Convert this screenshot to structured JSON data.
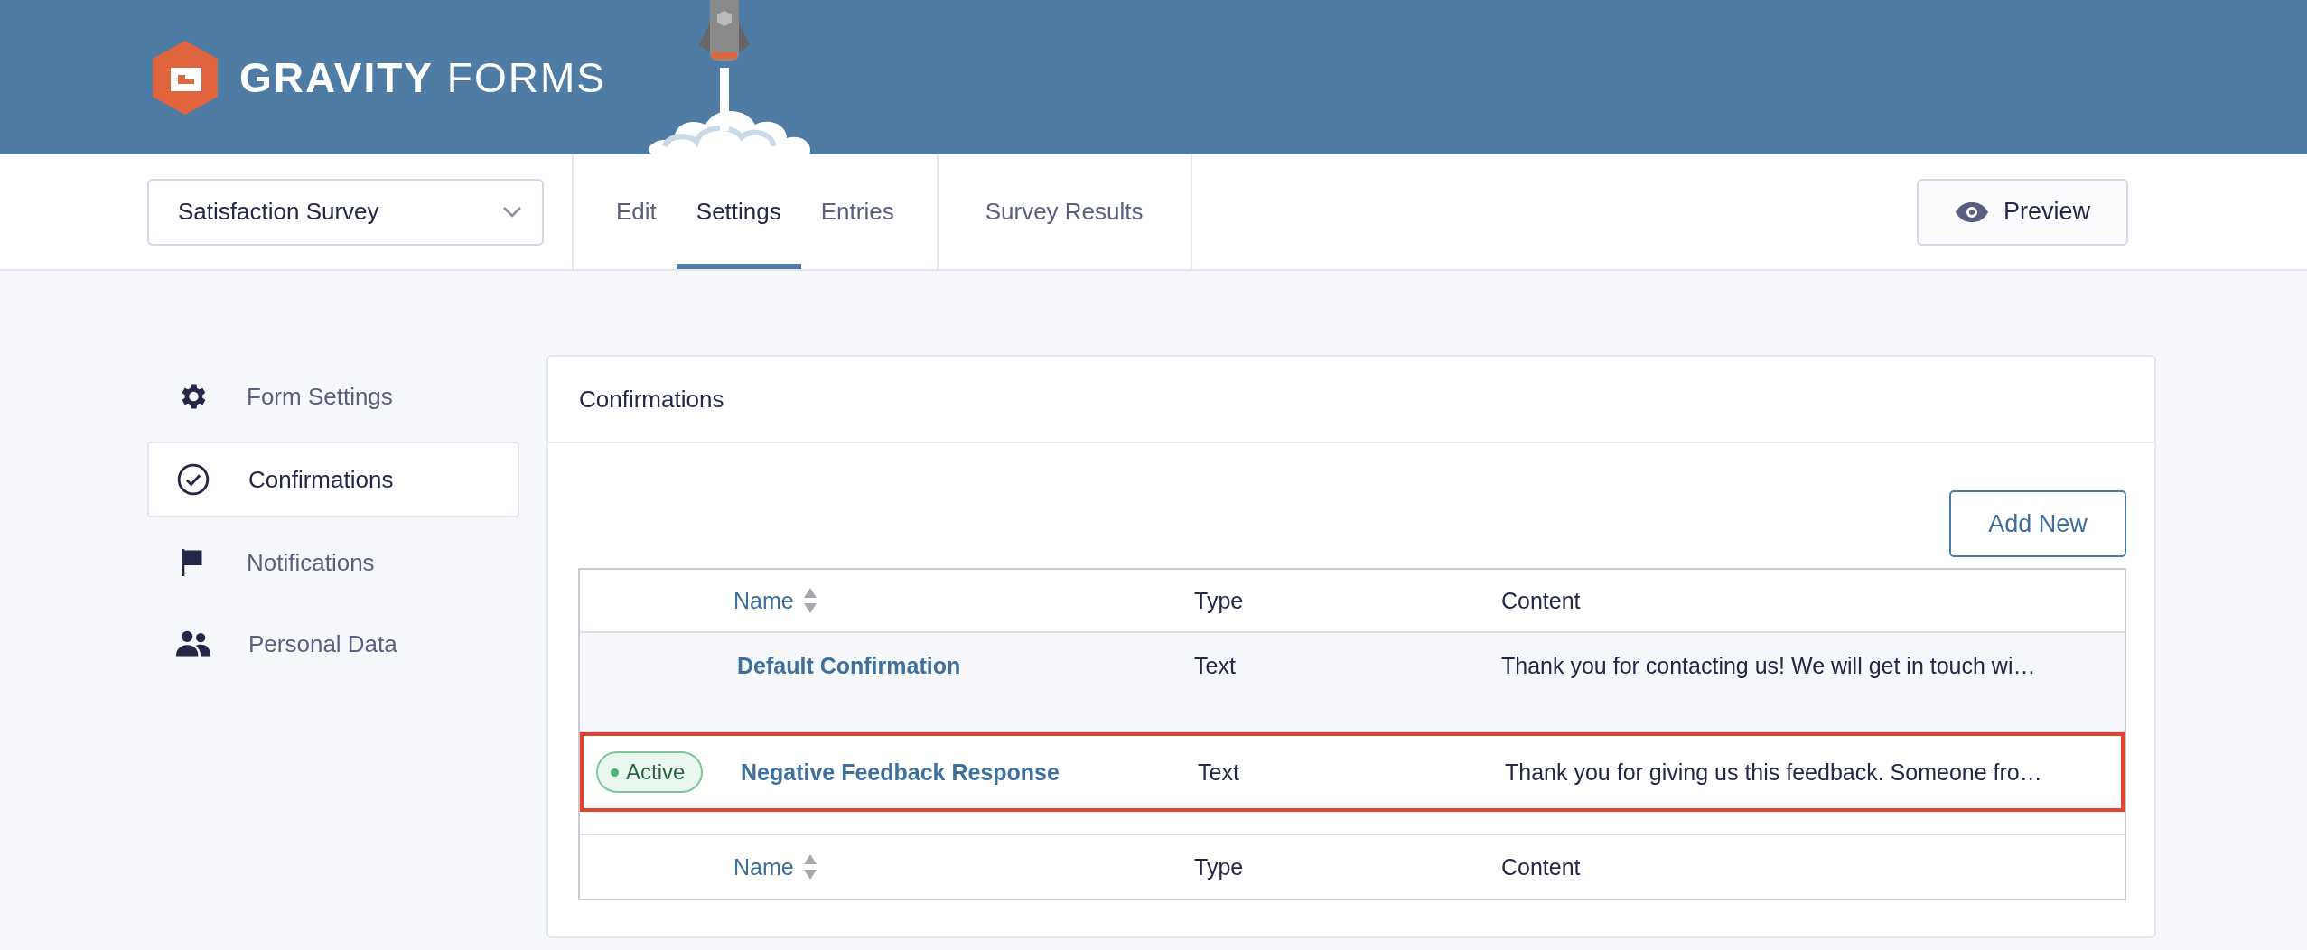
{
  "brand": {
    "name_bold": "GRAVITY",
    "name_light": "FORMS"
  },
  "form_selector": {
    "value": "Satisfaction Survey"
  },
  "nav_tabs": [
    {
      "label": "Edit",
      "selected": false
    },
    {
      "label": "Settings",
      "selected": true
    },
    {
      "label": "Entries",
      "selected": false
    }
  ],
  "extra_tab": {
    "label": "Survey Results"
  },
  "preview_button": "Preview",
  "sidebar": {
    "items": [
      {
        "label": "Form Settings",
        "selected": false
      },
      {
        "label": "Confirmations",
        "selected": true
      },
      {
        "label": "Notifications",
        "selected": false
      },
      {
        "label": "Personal Data",
        "selected": false
      }
    ]
  },
  "panel": {
    "title": "Confirmations",
    "add_button": "Add New",
    "table": {
      "columns": [
        "Name",
        "Type",
        "Content"
      ],
      "rows": [
        {
          "status": "",
          "name": "Default Confirmation",
          "type": "Text",
          "content": "Thank you for contacting us! We will get in touch wi…",
          "highlighted": false
        },
        {
          "status": "Active",
          "name": "Negative Feedback Response",
          "type": "Text",
          "content": "Thank you for giving us this feedback. Someone fro…",
          "highlighted": true
        }
      ],
      "footer_columns": [
        "Name",
        "Type",
        "Content"
      ]
    }
  }
}
